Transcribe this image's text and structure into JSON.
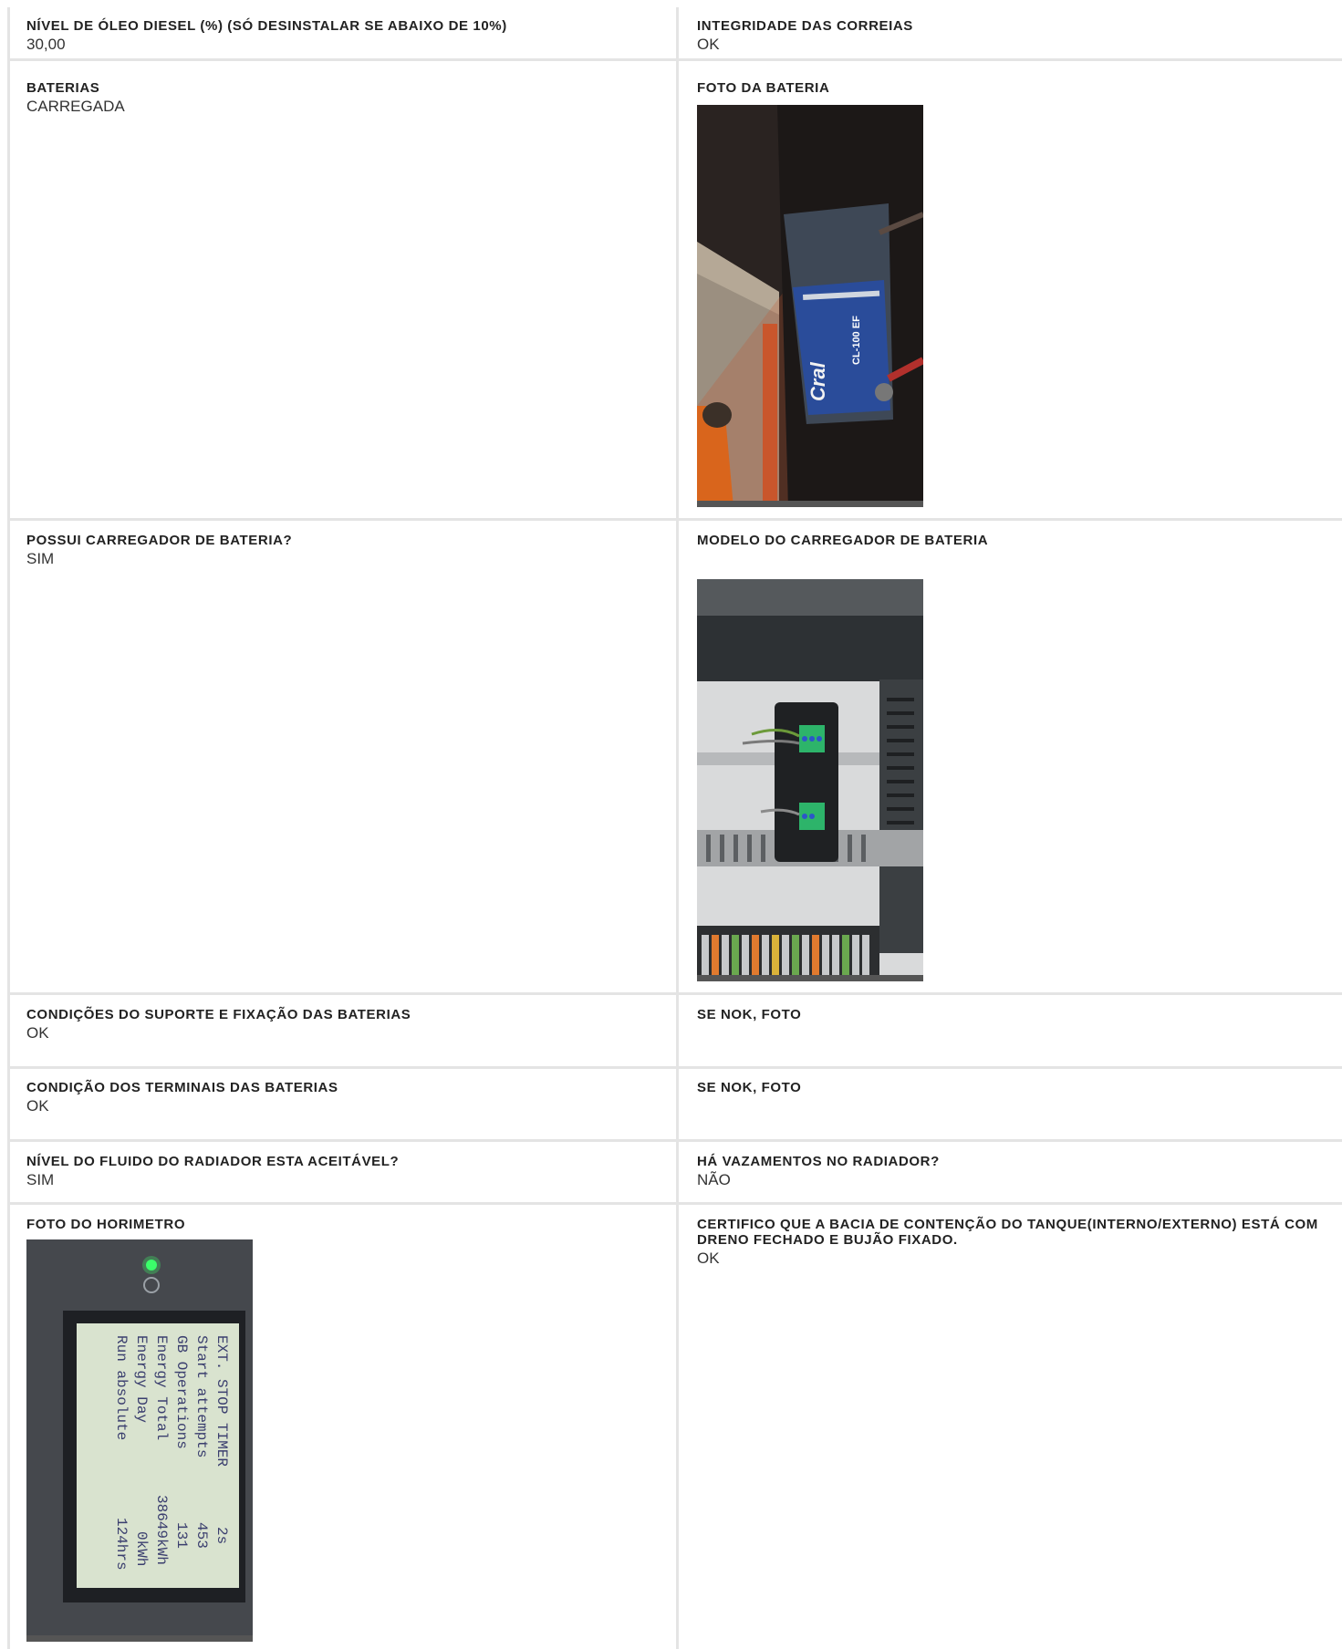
{
  "rows": [
    {
      "left": {
        "label": "NÍVEL DE ÓLEO DIESEL (%) (SÓ DESINSTALAR SE ABAIXO DE 10%)",
        "value": "30,00"
      },
      "right": {
        "label": "INTEGRIDADE DAS CORREIAS",
        "value": "OK"
      }
    },
    {
      "left": {
        "label": "BATERIAS",
        "value": "CARREGADA"
      },
      "right": {
        "label": "FOTO DA BATERIA",
        "photo": "battery-photo"
      }
    },
    {
      "left": {
        "label": "POSSUI CARREGADOR DE BATERIA?",
        "value": "SIM"
      },
      "right": {
        "label": "MODELO DO CARREGADOR DE BATERIA",
        "photo": "battery-charger-photo"
      }
    },
    {
      "left": {
        "label": "CONDIÇÕES DO SUPORTE E FIXAÇÃO DAS BATERIAS",
        "value": "OK"
      },
      "right": {
        "label": "SE NOK, FOTO",
        "value": ""
      }
    },
    {
      "left": {
        "label": "CONDIÇÃO DOS TERMINAIS DAS BATERIAS",
        "value": "OK"
      },
      "right": {
        "label": "SE NOK, FOTO",
        "value": ""
      }
    },
    {
      "left": {
        "label": "NÍVEL DO FLUIDO DO RADIADOR ESTA ACEITÁVEL?",
        "value": "SIM"
      },
      "right": {
        "label": "HÁ VAZAMENTOS NO RADIADOR?",
        "value": "NÃO"
      }
    },
    {
      "left": {
        "label": "FOTO DO HORIMETRO",
        "photo": "hour-meter-photo"
      },
      "right": {
        "label": "CERTIFICO QUE A BACIA DE CONTENÇÃO DO TANQUE(INTERNO/EXTERNO) ESTÁ COM DRENO FECHADO E BUJÃO FIXADO.",
        "value": "OK"
      }
    }
  ],
  "battery_photo": {
    "brand": "Cral",
    "model": "CL-100 EF"
  },
  "hour_meter_display": {
    "lines": [
      {
        "name": "EXT. STOP TIMER",
        "value": "2s"
      },
      {
        "name": "Start attempts",
        "value": "453"
      },
      {
        "name": "GB Operations",
        "value": "131"
      },
      {
        "name": "Energy Total",
        "value": "38649kWh"
      },
      {
        "name": "Energy Day",
        "value": "0kWh"
      },
      {
        "name": "Run absolute",
        "value": "124hrs"
      }
    ]
  },
  "colors": {
    "border": "#e4e4e4",
    "label": "#222222",
    "value": "#333333"
  }
}
